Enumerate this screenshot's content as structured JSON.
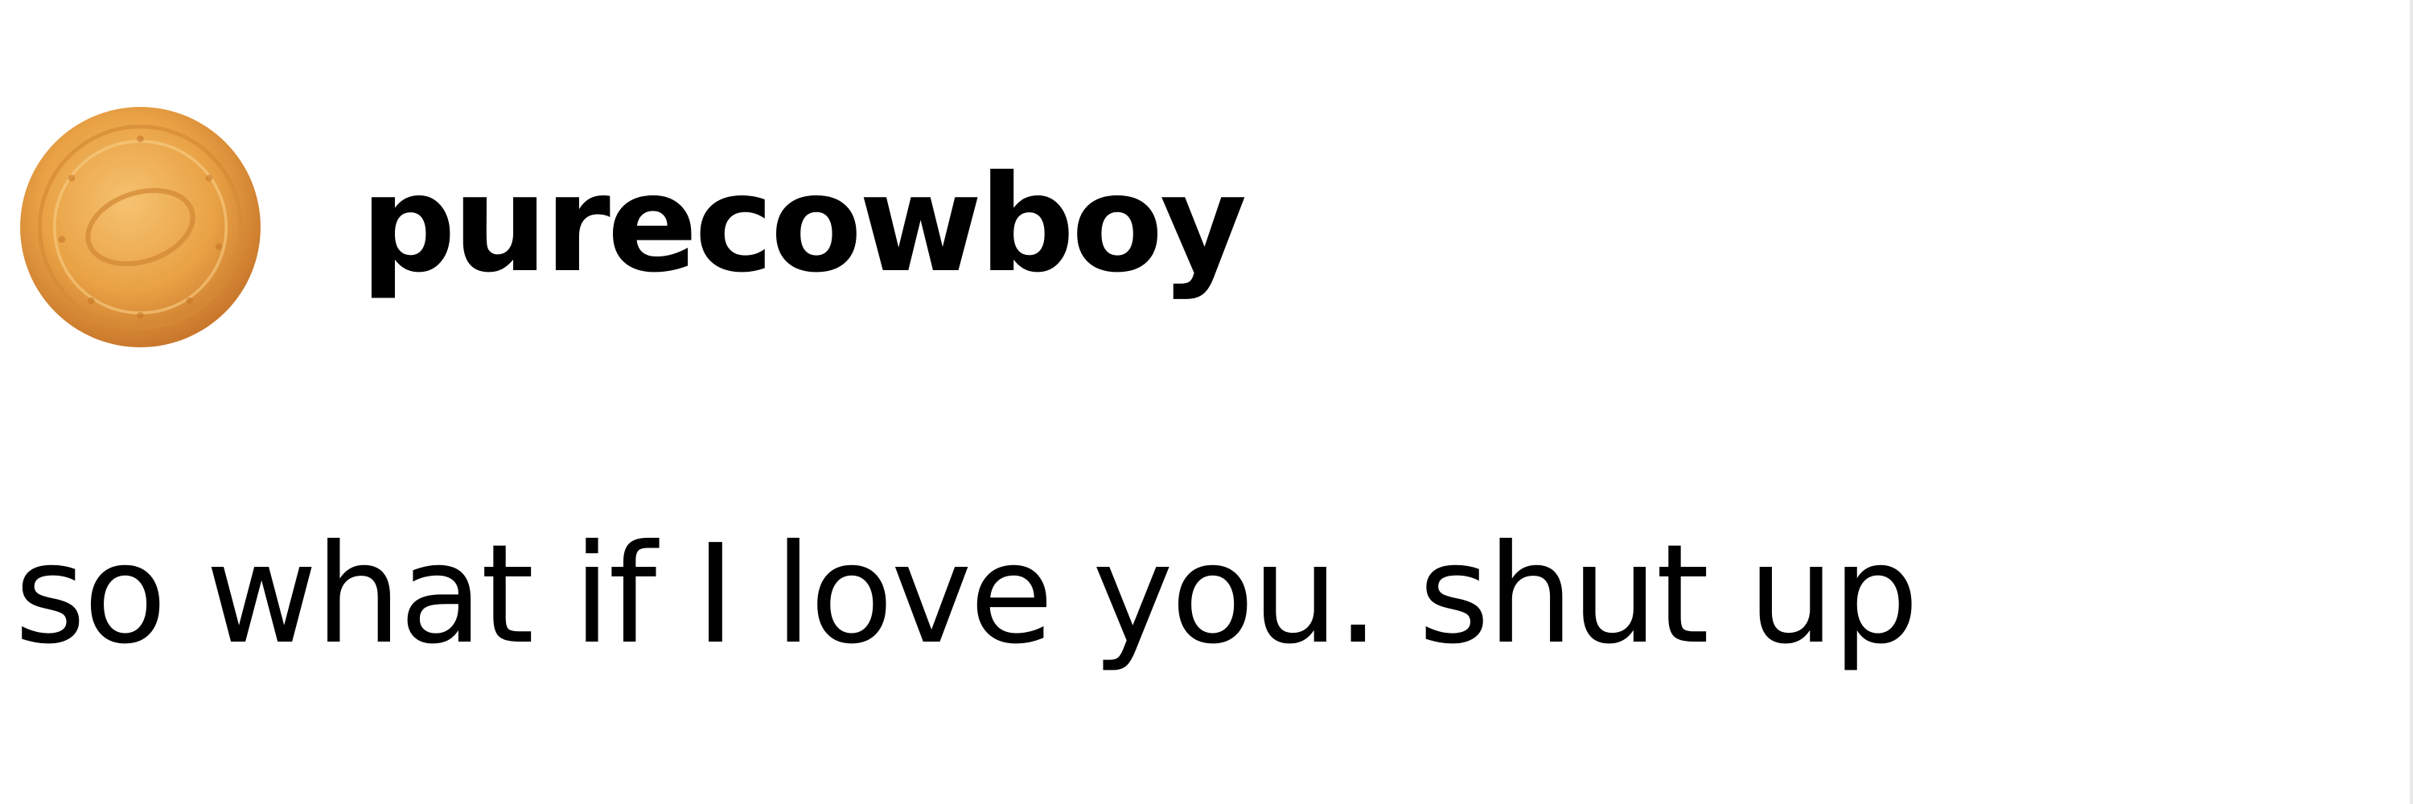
{
  "post": {
    "username": "purecowboy",
    "body_text": "so what if I love you. shut up",
    "avatar_icon": "biscuit-avatar-icon"
  },
  "colors": {
    "background": "#ffffff",
    "text": "#000000",
    "biscuit_light": "#f2b257",
    "biscuit_dark": "#c97a2c"
  }
}
